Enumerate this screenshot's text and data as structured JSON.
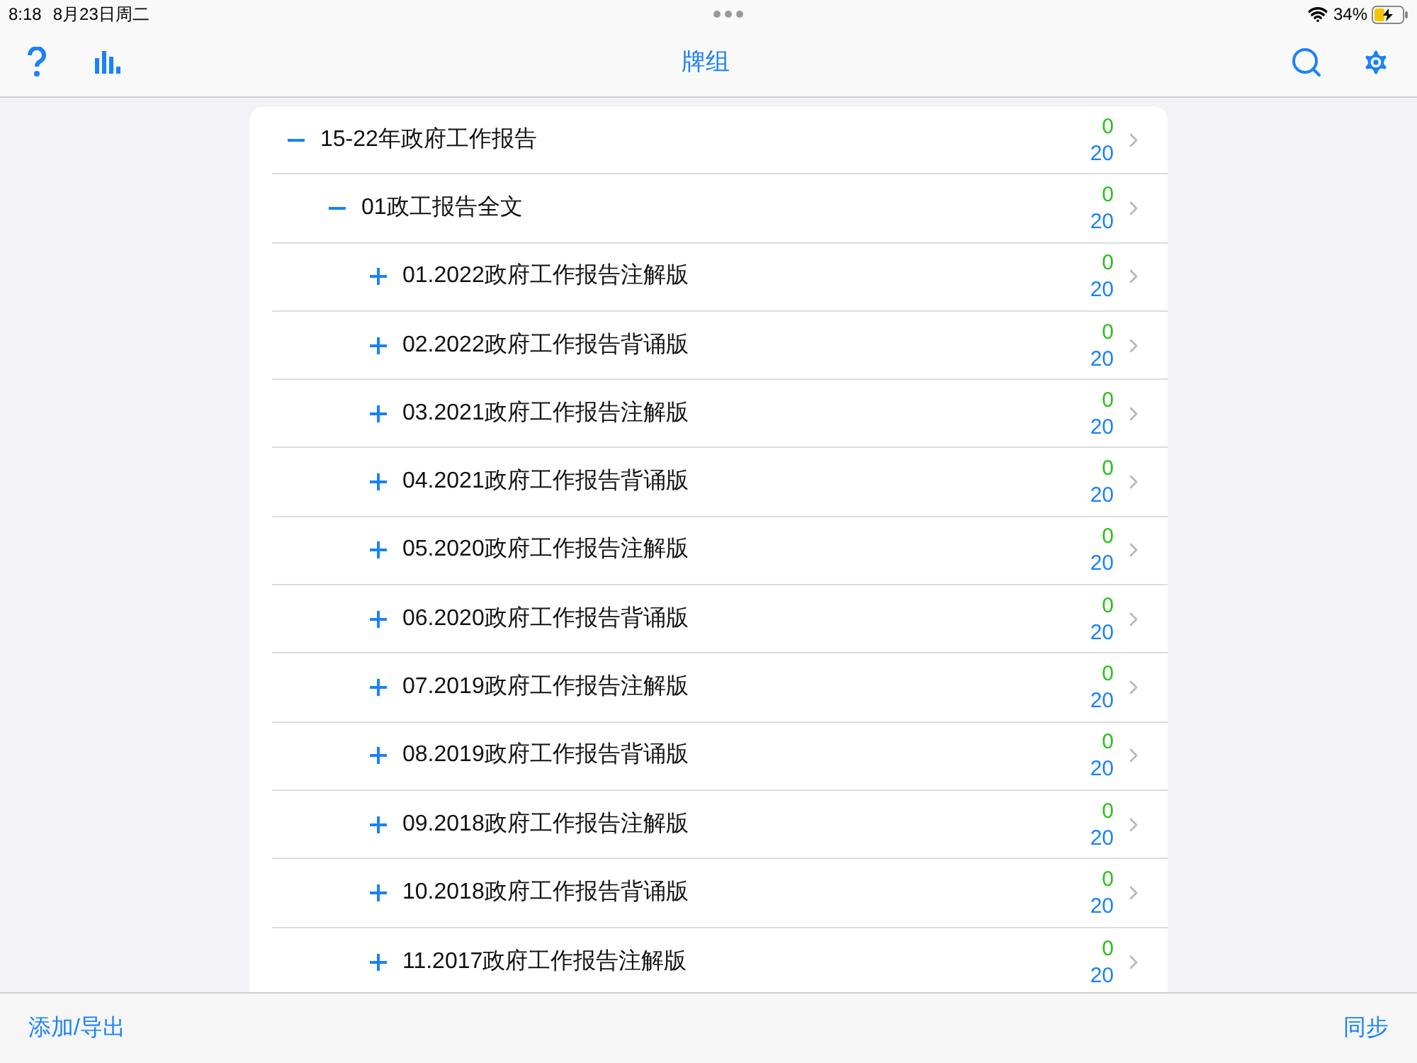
{
  "status_bar": {
    "time": "8:18",
    "date": "8月23日周二",
    "battery": "34%"
  },
  "nav": {
    "title": "牌组"
  },
  "decks": [
    {
      "name": "15-22年政府工作报告",
      "expanded": true,
      "due": "0",
      "total": "20",
      "children": [
        {
          "name": "01政工报告全文",
          "expanded": true,
          "due": "0",
          "total": "20",
          "children": [
            {
              "name": "01.2022政府工作报告注解版",
              "expanded": false,
              "due": "0",
              "total": "20"
            },
            {
              "name": "02.2022政府工作报告背诵版",
              "expanded": false,
              "due": "0",
              "total": "20"
            },
            {
              "name": "03.2021政府工作报告注解版",
              "expanded": false,
              "due": "0",
              "total": "20"
            },
            {
              "name": "04.2021政府工作报告背诵版",
              "expanded": false,
              "due": "0",
              "total": "20"
            },
            {
              "name": "05.2020政府工作报告注解版",
              "expanded": false,
              "due": "0",
              "total": "20"
            },
            {
              "name": "06.2020政府工作报告背诵版",
              "expanded": false,
              "due": "0",
              "total": "20"
            },
            {
              "name": "07.2019政府工作报告注解版",
              "expanded": false,
              "due": "0",
              "total": "20"
            },
            {
              "name": "08.2019政府工作报告背诵版",
              "expanded": false,
              "due": "0",
              "total": "20"
            },
            {
              "name": "09.2018政府工作报告注解版",
              "expanded": false,
              "due": "0",
              "total": "20"
            },
            {
              "name": "10.2018政府工作报告背诵版",
              "expanded": false,
              "due": "0",
              "total": "20"
            },
            {
              "name": "11.2017政府工作报告注解版",
              "expanded": false,
              "due": "0",
              "total": "20"
            }
          ]
        }
      ]
    }
  ],
  "toolbar": {
    "left": "添加/导出",
    "right": "同步"
  }
}
